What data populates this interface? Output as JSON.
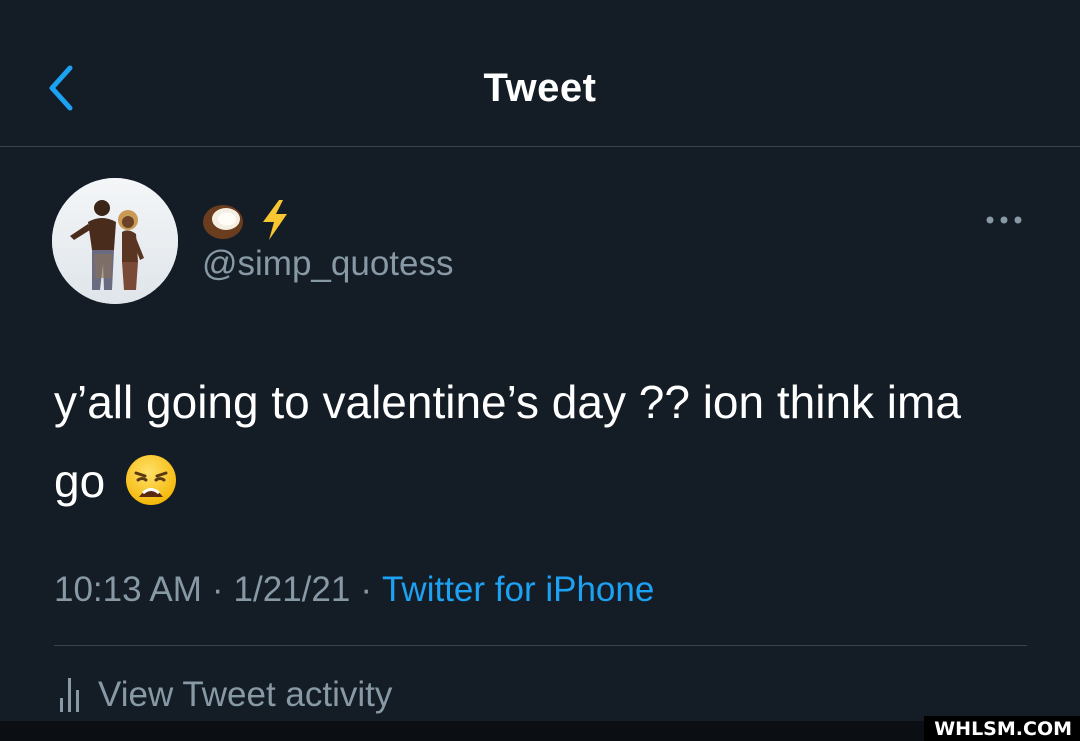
{
  "header": {
    "title": "Tweet",
    "back_icon": "chevron-left-icon",
    "accent_color": "#1da1f2"
  },
  "tweet": {
    "author": {
      "display_name_icons": [
        "coconut-icon",
        "lightning-bolt-icon"
      ],
      "handle": "@simp_quotess",
      "avatar": "avatar-photo"
    },
    "text": "y’all going to valentine’s day ?? ion think ima go",
    "text_emoji": "weary-face-icon",
    "time": "10:13 AM",
    "separator": "·",
    "date": "1/21/21",
    "source": "Twitter for iPhone",
    "more_icon": "more-horizontal-icon"
  },
  "activity": {
    "label": "View Tweet activity",
    "icon": "bar-chart-icon"
  },
  "watermark": "WHLSM.COM",
  "colors": {
    "background": "#141c26",
    "secondary_text": "#8899a6",
    "divider": "#38444d"
  }
}
